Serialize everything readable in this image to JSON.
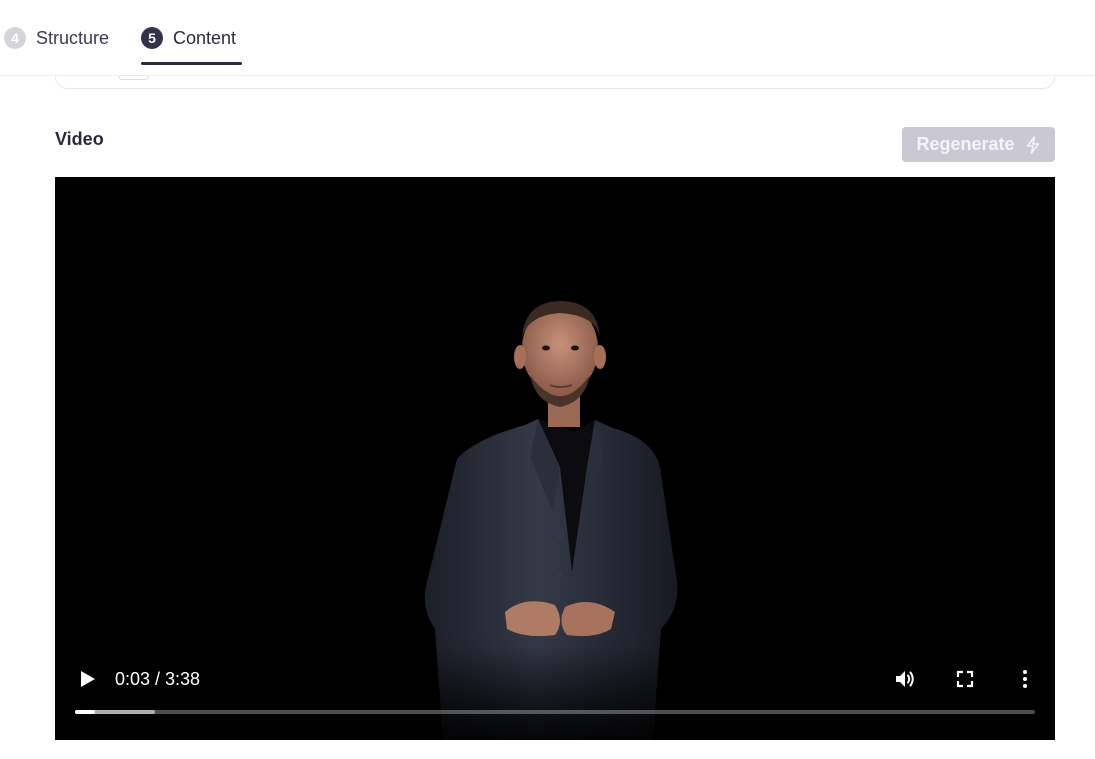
{
  "steps": [
    {
      "number": "4",
      "label": "Structure",
      "state": "completed"
    },
    {
      "number": "5",
      "label": "Content",
      "state": "active"
    }
  ],
  "section": {
    "title": "Video"
  },
  "regenerate": {
    "label": "Regenerate",
    "icon": "lightning-bolt-icon",
    "disabled": true
  },
  "video": {
    "current_time": "0:03",
    "duration": "3:38",
    "time_display": "0:03 / 3:38",
    "played_fraction": 0.021,
    "buffered_fraction": 0.083,
    "icons": {
      "play": "play-icon",
      "volume": "volume-icon",
      "fullscreen": "fullscreen-icon",
      "more": "more-vertical-icon"
    }
  },
  "colors": {
    "accent": "#2b2a3a",
    "step_inactive": "#d5d4de",
    "button_disabled": "#c9c8d3",
    "video_bg": "#000000"
  }
}
